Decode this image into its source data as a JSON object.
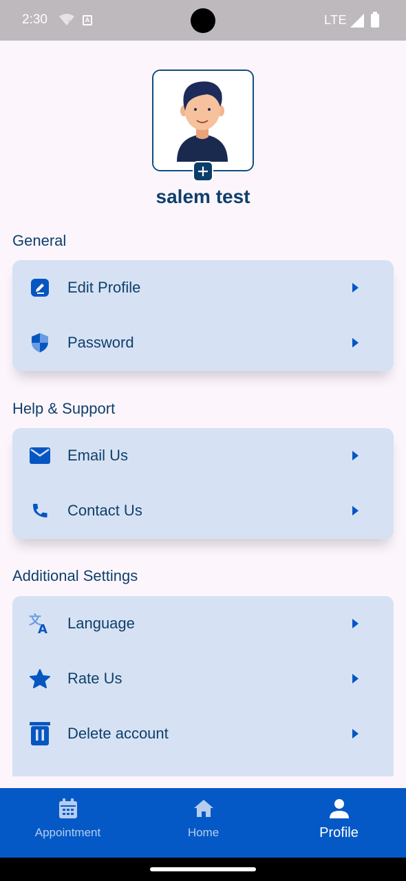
{
  "status_bar": {
    "time": "2:30",
    "network": "LTE",
    "keyboard_badge": "A"
  },
  "profile": {
    "name": "salem test"
  },
  "sections": {
    "general": {
      "title": "General",
      "items": [
        {
          "label": "Edit Profile",
          "icon": "edit-icon"
        },
        {
          "label": "Password",
          "icon": "shield-icon"
        }
      ]
    },
    "help": {
      "title": "Help & Support",
      "items": [
        {
          "label": "Email Us",
          "icon": "mail-icon"
        },
        {
          "label": "Contact Us",
          "icon": "phone-icon"
        }
      ]
    },
    "additional": {
      "title": "Additional Settings",
      "items": [
        {
          "label": "Language",
          "icon": "translate-icon"
        },
        {
          "label": "Rate Us",
          "icon": "star-icon"
        },
        {
          "label": "Delete account",
          "icon": "trash-icon"
        }
      ]
    }
  },
  "bottom_nav": {
    "items": [
      {
        "label": "Appointment",
        "icon": "calendar-icon",
        "active": false
      },
      {
        "label": "Home",
        "icon": "home-icon",
        "active": false
      },
      {
        "label": "Profile",
        "icon": "person-icon",
        "active": true
      }
    ]
  },
  "colors": {
    "primary": "#0559c6",
    "text": "#0f3f6b",
    "card": "#d6e2f3",
    "background": "#fcf6fc"
  }
}
